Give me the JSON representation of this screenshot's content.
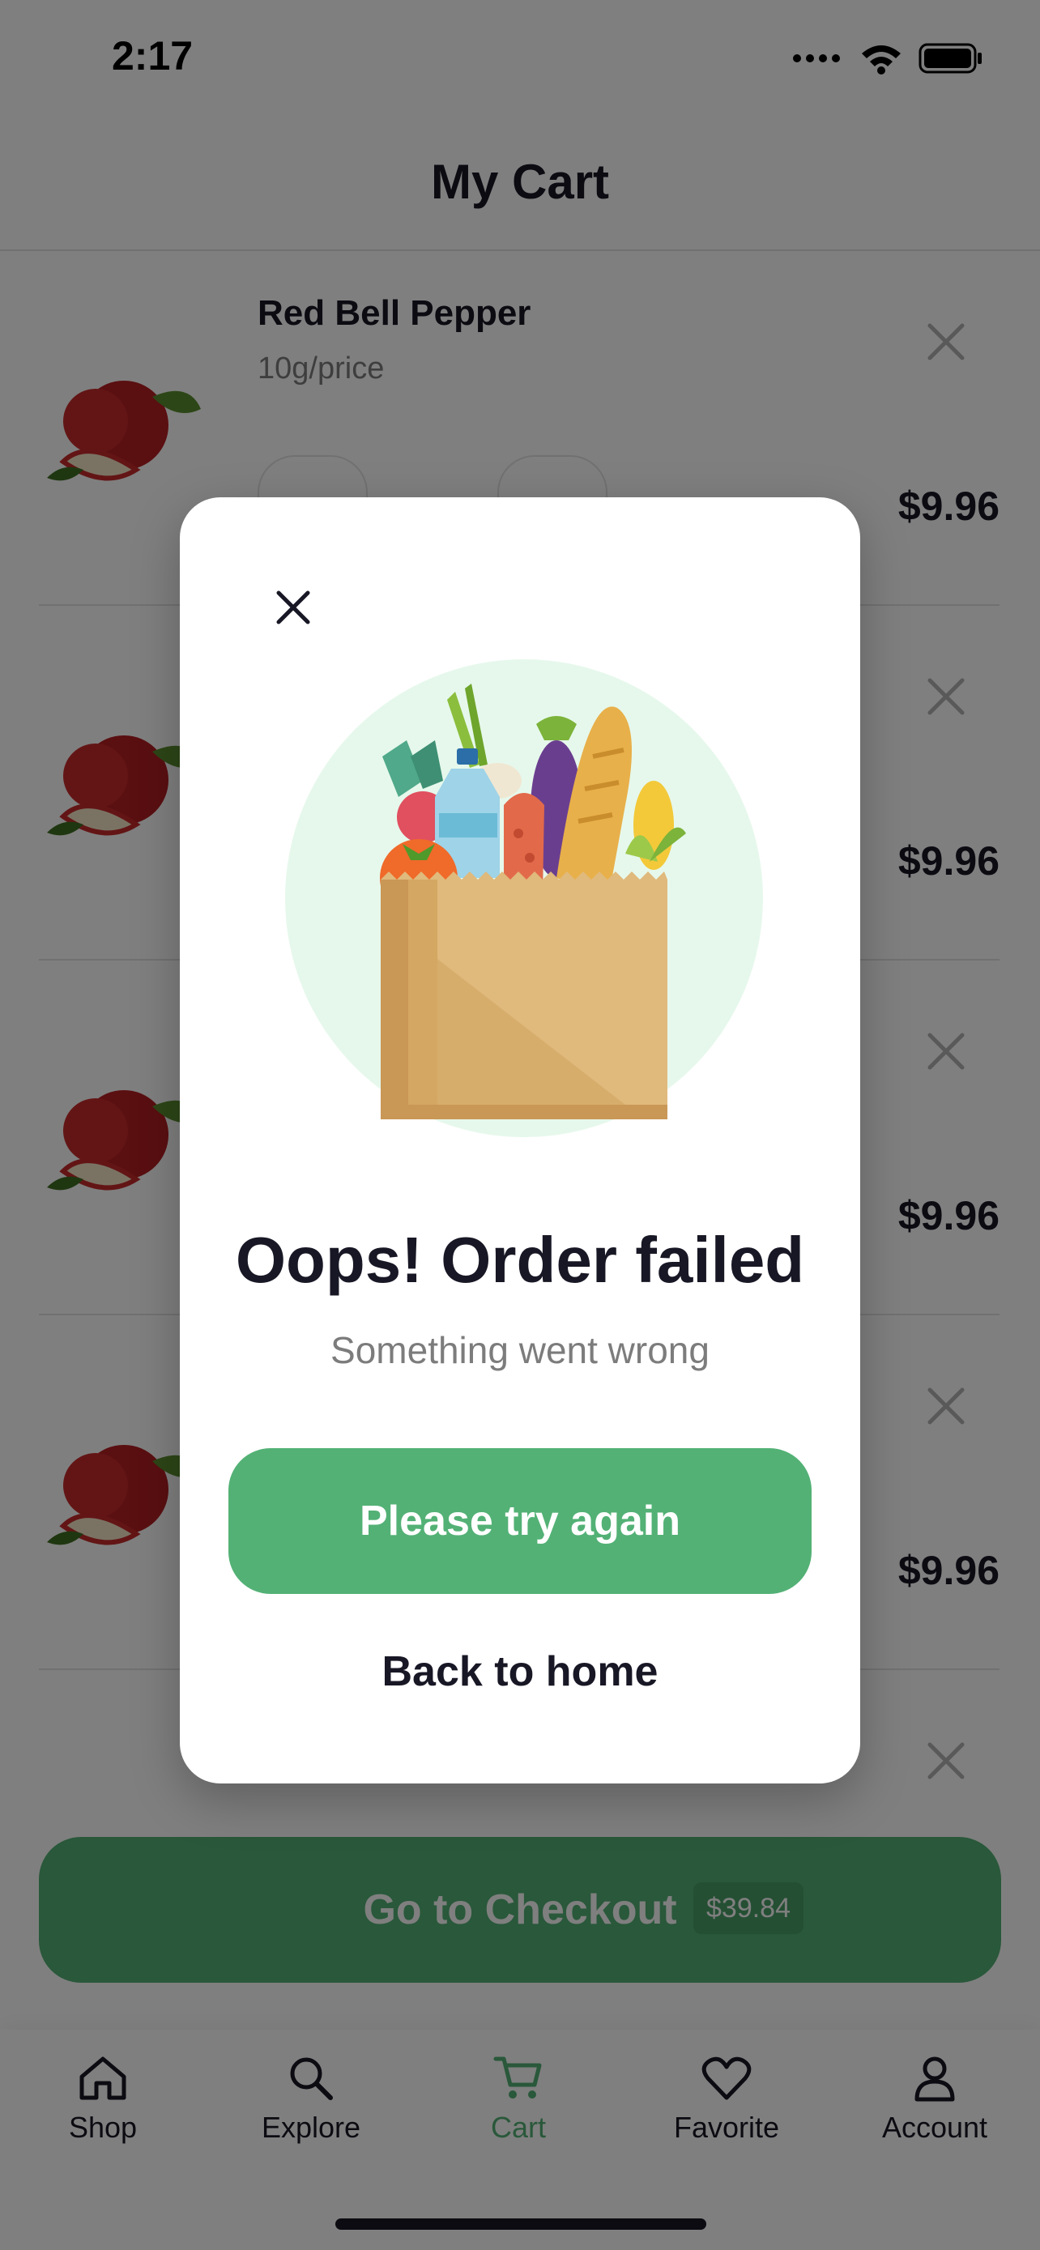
{
  "status_bar": {
    "time": "2:17"
  },
  "header": {
    "title": "My Cart"
  },
  "cart": {
    "items": [
      {
        "name": "Red Bell Pepper",
        "unit": "10g/price",
        "price": "$9.96"
      },
      {
        "price": "$9.96"
      },
      {
        "price": "$9.96"
      },
      {
        "price": "$9.96"
      },
      {
        "price": ""
      }
    ]
  },
  "checkout": {
    "label": "Go to Checkout",
    "total": "$39.84"
  },
  "tab_bar": {
    "items": [
      {
        "label": "Shop",
        "icon": "home-icon"
      },
      {
        "label": "Explore",
        "icon": "search-icon"
      },
      {
        "label": "Cart",
        "icon": "cart-icon",
        "active": true
      },
      {
        "label": "Favorite",
        "icon": "heart-icon"
      },
      {
        "label": "Account",
        "icon": "user-icon"
      }
    ]
  },
  "modal": {
    "title": "Oops! Order failed",
    "subtitle": "Something went wrong",
    "retry_label": "Please try again",
    "back_label": "Back to home"
  },
  "colors": {
    "accent": "#53b175",
    "text": "#181725",
    "muted": "#7c7c7c",
    "overlay": "rgba(0,0,0,0.5)"
  }
}
